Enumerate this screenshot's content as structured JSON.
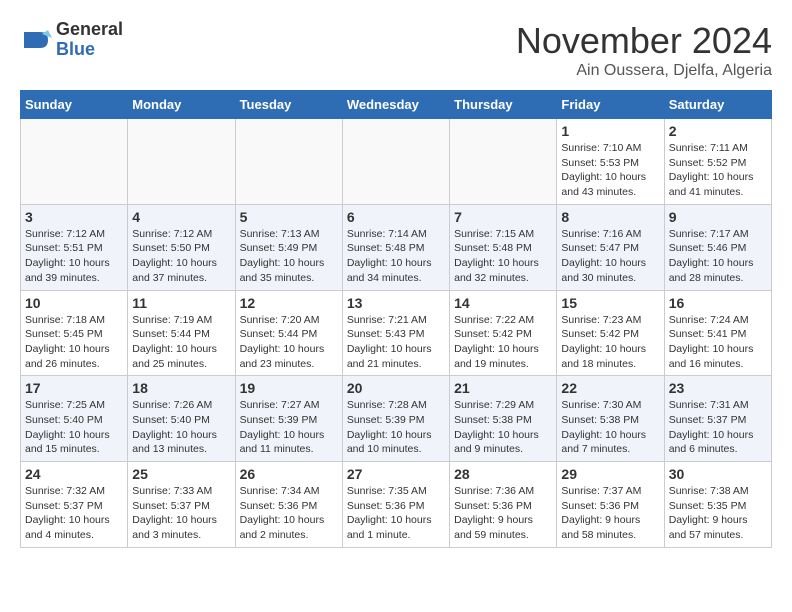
{
  "logo": {
    "general": "General",
    "blue": "Blue"
  },
  "header": {
    "month": "November 2024",
    "location": "Ain Oussera, Djelfa, Algeria"
  },
  "weekdays": [
    "Sunday",
    "Monday",
    "Tuesday",
    "Wednesday",
    "Thursday",
    "Friday",
    "Saturday"
  ],
  "weeks": [
    {
      "days": [
        {
          "num": "",
          "info": ""
        },
        {
          "num": "",
          "info": ""
        },
        {
          "num": "",
          "info": ""
        },
        {
          "num": "",
          "info": ""
        },
        {
          "num": "",
          "info": ""
        },
        {
          "num": "1",
          "info": "Sunrise: 7:10 AM\nSunset: 5:53 PM\nDaylight: 10 hours and 43 minutes."
        },
        {
          "num": "2",
          "info": "Sunrise: 7:11 AM\nSunset: 5:52 PM\nDaylight: 10 hours and 41 minutes."
        }
      ]
    },
    {
      "days": [
        {
          "num": "3",
          "info": "Sunrise: 7:12 AM\nSunset: 5:51 PM\nDaylight: 10 hours and 39 minutes."
        },
        {
          "num": "4",
          "info": "Sunrise: 7:12 AM\nSunset: 5:50 PM\nDaylight: 10 hours and 37 minutes."
        },
        {
          "num": "5",
          "info": "Sunrise: 7:13 AM\nSunset: 5:49 PM\nDaylight: 10 hours and 35 minutes."
        },
        {
          "num": "6",
          "info": "Sunrise: 7:14 AM\nSunset: 5:48 PM\nDaylight: 10 hours and 34 minutes."
        },
        {
          "num": "7",
          "info": "Sunrise: 7:15 AM\nSunset: 5:48 PM\nDaylight: 10 hours and 32 minutes."
        },
        {
          "num": "8",
          "info": "Sunrise: 7:16 AM\nSunset: 5:47 PM\nDaylight: 10 hours and 30 minutes."
        },
        {
          "num": "9",
          "info": "Sunrise: 7:17 AM\nSunset: 5:46 PM\nDaylight: 10 hours and 28 minutes."
        }
      ]
    },
    {
      "days": [
        {
          "num": "10",
          "info": "Sunrise: 7:18 AM\nSunset: 5:45 PM\nDaylight: 10 hours and 26 minutes."
        },
        {
          "num": "11",
          "info": "Sunrise: 7:19 AM\nSunset: 5:44 PM\nDaylight: 10 hours and 25 minutes."
        },
        {
          "num": "12",
          "info": "Sunrise: 7:20 AM\nSunset: 5:44 PM\nDaylight: 10 hours and 23 minutes."
        },
        {
          "num": "13",
          "info": "Sunrise: 7:21 AM\nSunset: 5:43 PM\nDaylight: 10 hours and 21 minutes."
        },
        {
          "num": "14",
          "info": "Sunrise: 7:22 AM\nSunset: 5:42 PM\nDaylight: 10 hours and 19 minutes."
        },
        {
          "num": "15",
          "info": "Sunrise: 7:23 AM\nSunset: 5:42 PM\nDaylight: 10 hours and 18 minutes."
        },
        {
          "num": "16",
          "info": "Sunrise: 7:24 AM\nSunset: 5:41 PM\nDaylight: 10 hours and 16 minutes."
        }
      ]
    },
    {
      "days": [
        {
          "num": "17",
          "info": "Sunrise: 7:25 AM\nSunset: 5:40 PM\nDaylight: 10 hours and 15 minutes."
        },
        {
          "num": "18",
          "info": "Sunrise: 7:26 AM\nSunset: 5:40 PM\nDaylight: 10 hours and 13 minutes."
        },
        {
          "num": "19",
          "info": "Sunrise: 7:27 AM\nSunset: 5:39 PM\nDaylight: 10 hours and 11 minutes."
        },
        {
          "num": "20",
          "info": "Sunrise: 7:28 AM\nSunset: 5:39 PM\nDaylight: 10 hours and 10 minutes."
        },
        {
          "num": "21",
          "info": "Sunrise: 7:29 AM\nSunset: 5:38 PM\nDaylight: 10 hours and 9 minutes."
        },
        {
          "num": "22",
          "info": "Sunrise: 7:30 AM\nSunset: 5:38 PM\nDaylight: 10 hours and 7 minutes."
        },
        {
          "num": "23",
          "info": "Sunrise: 7:31 AM\nSunset: 5:37 PM\nDaylight: 10 hours and 6 minutes."
        }
      ]
    },
    {
      "days": [
        {
          "num": "24",
          "info": "Sunrise: 7:32 AM\nSunset: 5:37 PM\nDaylight: 10 hours and 4 minutes."
        },
        {
          "num": "25",
          "info": "Sunrise: 7:33 AM\nSunset: 5:37 PM\nDaylight: 10 hours and 3 minutes."
        },
        {
          "num": "26",
          "info": "Sunrise: 7:34 AM\nSunset: 5:36 PM\nDaylight: 10 hours and 2 minutes."
        },
        {
          "num": "27",
          "info": "Sunrise: 7:35 AM\nSunset: 5:36 PM\nDaylight: 10 hours and 1 minute."
        },
        {
          "num": "28",
          "info": "Sunrise: 7:36 AM\nSunset: 5:36 PM\nDaylight: 9 hours and 59 minutes."
        },
        {
          "num": "29",
          "info": "Sunrise: 7:37 AM\nSunset: 5:36 PM\nDaylight: 9 hours and 58 minutes."
        },
        {
          "num": "30",
          "info": "Sunrise: 7:38 AM\nSunset: 5:35 PM\nDaylight: 9 hours and 57 minutes."
        }
      ]
    }
  ]
}
